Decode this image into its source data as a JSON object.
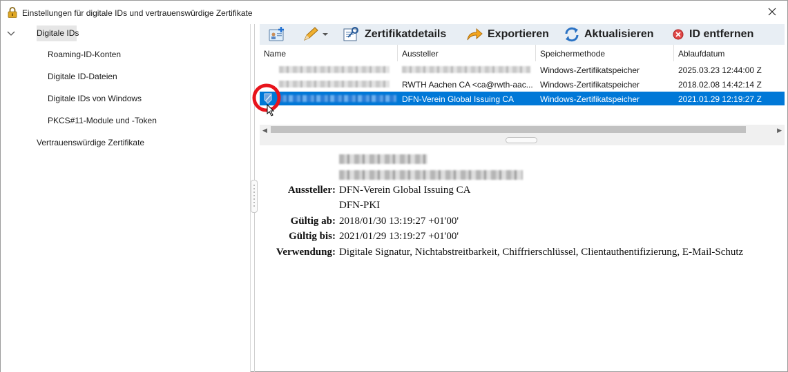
{
  "window": {
    "title": "Einstellungen für digitale IDs und vertrauenswürdige Zertifikate"
  },
  "nav": {
    "items": [
      {
        "label": "Digitale IDs"
      },
      {
        "label": "Roaming-ID-Konten"
      },
      {
        "label": "Digitale ID-Dateien"
      },
      {
        "label": "Digitale IDs von Windows"
      },
      {
        "label": "PKCS#11-Module und -Token"
      },
      {
        "label": "Vertrauenswürdige Zertifikate"
      }
    ]
  },
  "toolbar": {
    "details_label": "Zertifikatdetails",
    "export_label": "Exportieren",
    "refresh_label": "Aktualisieren",
    "remove_label": "ID entfernen"
  },
  "table": {
    "columns": [
      "Name",
      "Aussteller",
      "Speichermethode",
      "Ablaufdatum"
    ],
    "rows": [
      {
        "issuer": "",
        "storage": "Windows-Zertifikatspeicher",
        "expiry": "2025.03.23 12:44:00 Z"
      },
      {
        "issuer": "RWTH Aachen CA <ca@rwth-aac...",
        "storage": "Windows-Zertifikatspeicher",
        "expiry": "2018.02.08 14:42:14 Z"
      },
      {
        "issuer": "DFN-Verein Global Issuing CA",
        "storage": "Windows-Zertifikatspeicher",
        "expiry": "2021.01.29 12:19:27 Z"
      }
    ]
  },
  "details": {
    "issuer_label": "Aussteller:",
    "issuer_line1": "DFN-Verein Global Issuing CA",
    "issuer_line2": "DFN-PKI",
    "valid_from_label": "Gültig ab:",
    "valid_from": "2018/01/30 13:19:27 +01'00'",
    "valid_to_label": "Gültig bis:",
    "valid_to": "2021/01/29 13:19:27 +01'00'",
    "usage_label": "Verwendung:",
    "usage": "Digitale Signatur, Nichtabstreitbarkeit, Chiffrierschlüssel, Clientauthentifizierung, E-Mail-Schutz"
  },
  "colors": {
    "selection": "#0078d7",
    "toolbar_bg": "#e8eef4",
    "annotation_circle": "#e8141c"
  },
  "icons": {
    "lock": "lock-icon",
    "close": "close-icon",
    "add_id": "add-id-icon",
    "edit": "pencil-icon",
    "details": "certificate-details-icon",
    "export": "export-arrow-icon",
    "refresh": "refresh-icon",
    "remove": "remove-icon",
    "certificate": "certificate-icon"
  }
}
